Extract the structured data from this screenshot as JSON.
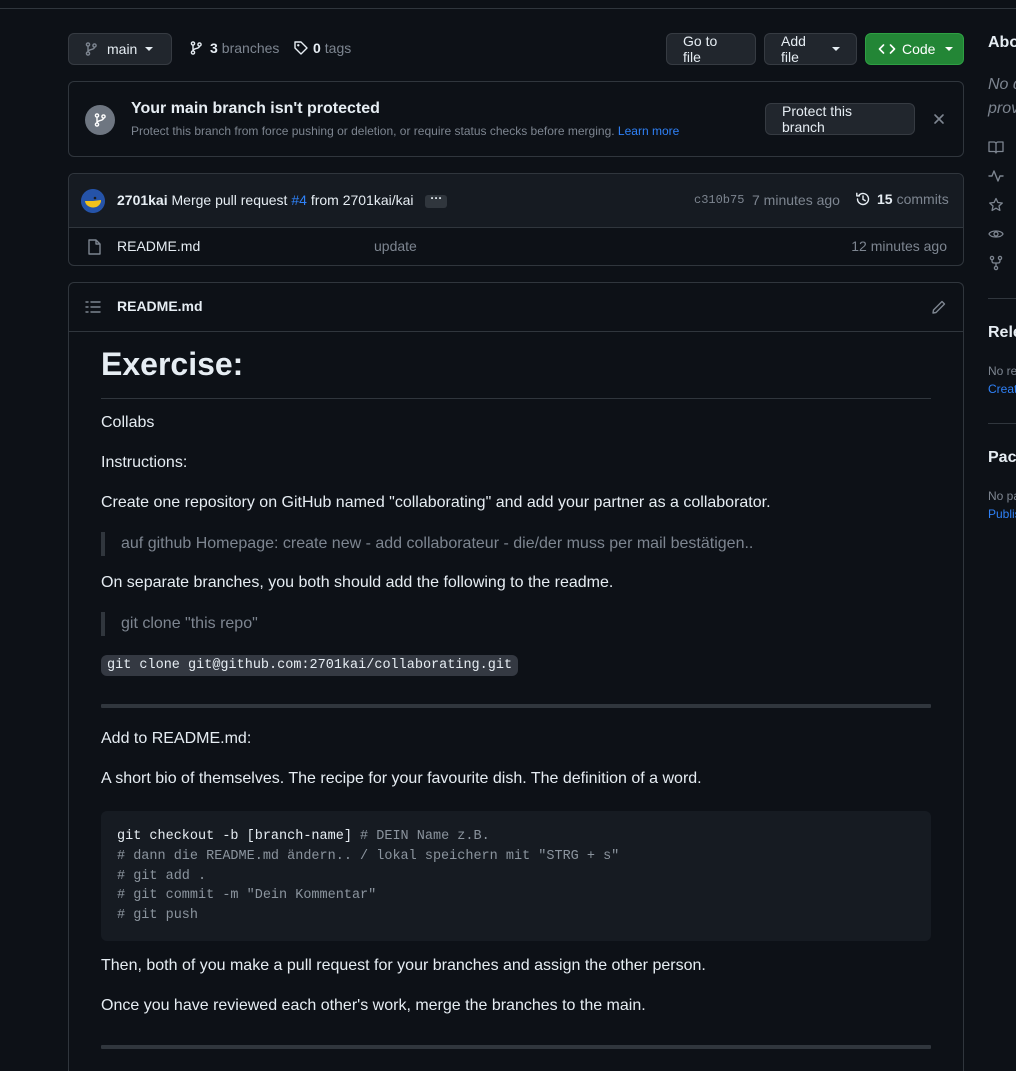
{
  "toolbar": {
    "branch_name": "main",
    "branches_count": "3",
    "branches_label": "branches",
    "tags_count": "0",
    "tags_label": "tags",
    "go_to_file": "Go to file",
    "add_file": "Add file",
    "code": "Code"
  },
  "banner": {
    "title": "Your main branch isn't protected",
    "description": "Protect this branch from force pushing or deletion, or require status checks before merging.",
    "learn_more": "Learn more",
    "protect_button": "Protect this branch"
  },
  "commit": {
    "author": "2701kai",
    "message_prefix": "Merge pull request",
    "pr_link": "#4",
    "message_suffix": "from 2701kai/kai",
    "ellipsis": "···",
    "sha": "c310b75",
    "time": "7 minutes ago",
    "commits_count": "15",
    "commits_label": "commits"
  },
  "files": [
    {
      "name": "README.md",
      "message": "update",
      "age": "12 minutes ago"
    }
  ],
  "readme": {
    "header_title": "README.md",
    "h1": "Exercise:",
    "p_collabs": "Collabs",
    "p_instructions": "Instructions:",
    "p_create": "Create one repository on GitHub named \"collaborating\" and add your partner as a collaborator.",
    "quote_1": "auf github Homepage: create new - add collaborateur - die/der muss per mail bestätigen..",
    "p_separate": "On separate branches, you both should add the following to the readme.",
    "quote_2": "git clone \"this repo\"",
    "inline_code": "git clone git@github.com:2701kai/collaborating.git",
    "p_add": "Add to README.md:",
    "p_bio": "A short bio of themselves. The recipe for your favourite dish. The definition of a word.",
    "code_line1_cmd": "git checkout -b [branch-name]",
    "code_line1_comment": " # DEIN Name z.B.",
    "code_line2": "# dann die README.md ändern.. / lokal speichern mit \"STRG + s\"",
    "code_line3": "# git add .",
    "code_line4": "# git commit -m \"Dein Kommentar\"",
    "code_line5": "# git push",
    "p_then": "Then, both of you make a pull request for your branches and assign the other person.",
    "p_once": "Once you have reviewed each other's work, merge the branches to the main."
  },
  "sidebar": {
    "about_title": "Abo",
    "about_desc_1": "No d",
    "about_desc_2": "prov",
    "releases_title": "Rele",
    "releases_none": "No re",
    "releases_create": "Creat",
    "packages_title": "Pac",
    "packages_none": "No pa",
    "packages_publish": "Publis"
  },
  "colors": {
    "background": "#0d1117",
    "border": "#30363d",
    "accent_green": "#238636",
    "link_blue": "#2f81f7",
    "muted": "#7d8590"
  }
}
